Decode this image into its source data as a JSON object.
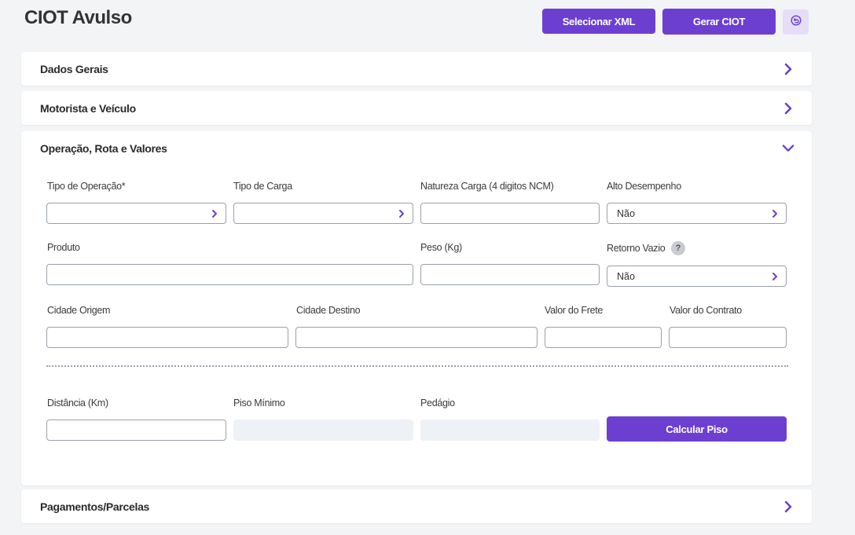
{
  "page": {
    "title": "CIOT Avulso"
  },
  "toolbar": {
    "select_xml_label": "Selecionar XML",
    "generate_ciot_label": "Gerar CIOT",
    "undo_icon": "undo-icon",
    "accent_color": "#6c3fd1"
  },
  "sections": [
    {
      "title": "Dados Gerais",
      "expanded": false
    },
    {
      "title": "Motorista e Veículo",
      "expanded": false
    },
    {
      "title": "Operação, Rota e Valores",
      "expanded": true
    },
    {
      "title": "Pagamentos/Parcelas",
      "expanded": false
    }
  ],
  "form": {
    "tipo_operacao": {
      "label": "Tipo de Operação*",
      "value": ""
    },
    "tipo_carga": {
      "label": "Tipo de Carga",
      "value": ""
    },
    "natureza_carga": {
      "label": "Natureza Carga (4 digitos NCM)",
      "value": ""
    },
    "alto_desempenho": {
      "label": "Alto Desempenho",
      "value": "Não"
    },
    "produto": {
      "label": "Produto",
      "value": ""
    },
    "peso": {
      "label": "Peso (Kg)",
      "value": ""
    },
    "retorno_vazio": {
      "label": "Retorno Vazio",
      "value": "Não",
      "help": "?"
    },
    "cidade_origem": {
      "label": "Cidade Origem",
      "value": ""
    },
    "cidade_destino": {
      "label": "Cidade Destino",
      "value": ""
    },
    "valor_frete": {
      "label": "Valor do Frete",
      "value": ""
    },
    "valor_contrato": {
      "label": "Valor do Contrato",
      "value": ""
    },
    "distancia": {
      "label": "Distância (Km)",
      "value": ""
    },
    "piso_minimo": {
      "label": "Piso Mínimo",
      "value": ""
    },
    "pedagio": {
      "label": "Pedágio",
      "value": ""
    },
    "calcular_piso_label": "Calcular Piso"
  }
}
